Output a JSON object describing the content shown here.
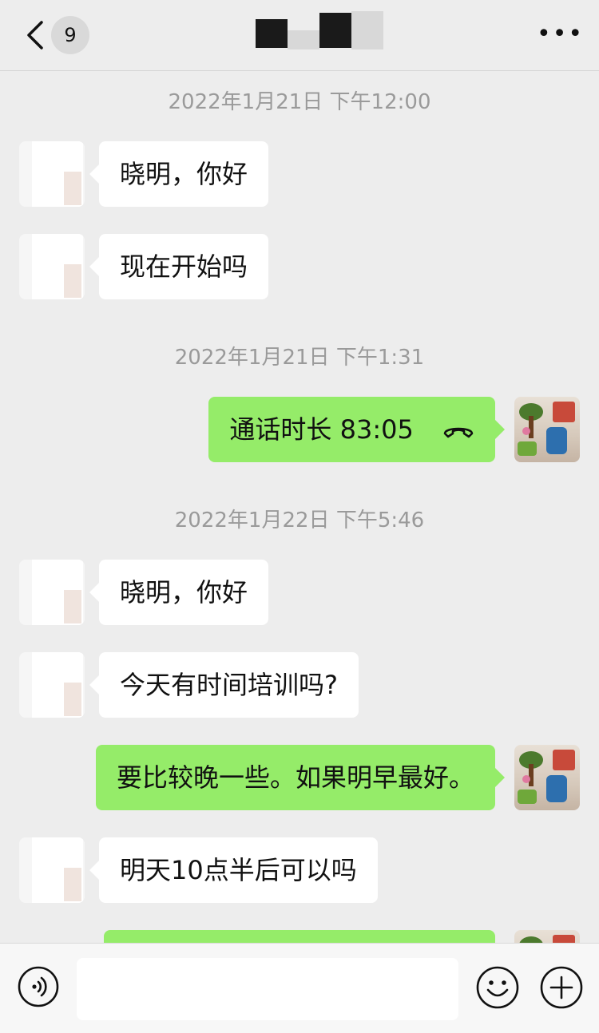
{
  "header": {
    "back_badge": "9",
    "title": "",
    "more_label": "•••"
  },
  "messages": [
    {
      "type": "timestamp",
      "text": "2022年1月21日 下午12:00"
    },
    {
      "type": "incoming",
      "text": "晓明，你好"
    },
    {
      "type": "incoming",
      "text": "现在开始吗"
    },
    {
      "type": "timestamp",
      "text": "2022年1月21日 下午1:31"
    },
    {
      "type": "outgoing_call",
      "text": "通话时长 83:05",
      "icon": "phone-hangup-icon"
    },
    {
      "type": "timestamp",
      "text": "2022年1月22日 下午5:46"
    },
    {
      "type": "incoming",
      "text": "晓明，你好"
    },
    {
      "type": "incoming",
      "text": "今天有时间培训吗?"
    },
    {
      "type": "outgoing",
      "text": "要比较晚一些。如果明早最好。"
    },
    {
      "type": "incoming",
      "text": "明天10点半后可以吗"
    },
    {
      "type": "outgoing",
      "text": ""
    }
  ],
  "composer": {
    "input_value": "",
    "voice_icon": "voice-icon",
    "emoji_icon": "emoji-icon",
    "plus_icon": "plus-icon"
  },
  "colors": {
    "background": "#ededed",
    "outgoing_bubble": "#95ec69",
    "incoming_bubble": "#ffffff",
    "timestamp_text": "#9a9a9a"
  }
}
